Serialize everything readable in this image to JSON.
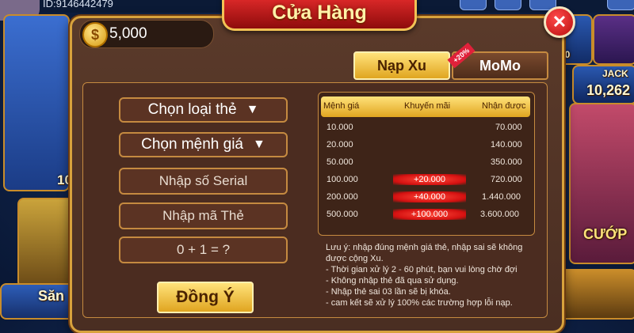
{
  "background": {
    "user_id": "ID:9146442479",
    "left_label": "Săn",
    "left_label2": "10",
    "right_jackpot_label": "JACK",
    "right_jackpot_value": "10,262",
    "right_top_value": "00",
    "right_label": "CƯỚP"
  },
  "dialog": {
    "title": "Cửa Hàng",
    "balance": "5,000",
    "coin_symbol": "$",
    "tabs": [
      {
        "label": "Nạp Xu",
        "active": true
      },
      {
        "label": "MoMo",
        "active": false,
        "badge": "+20%"
      }
    ],
    "form": {
      "card_type": "Chọn loại thẻ",
      "card_value": "Chọn mệnh giá",
      "serial_placeholder": "Nhập số Serial",
      "code_placeholder": "Nhập mã Thẻ",
      "captcha": "0 + 1 = ?",
      "arrow": "▼",
      "submit_label": "Đồng Ý"
    },
    "rate_table": {
      "headers": [
        "Mệnh giá",
        "Khuyến mãi",
        "Nhận được"
      ],
      "rows": [
        {
          "value": "10.000",
          "bonus": "",
          "receive": "70.000"
        },
        {
          "value": "20.000",
          "bonus": "",
          "receive": "140.000"
        },
        {
          "value": "50.000",
          "bonus": "",
          "receive": "350.000"
        },
        {
          "value": "100.000",
          "bonus": "+20.000",
          "receive": "720.000"
        },
        {
          "value": "200.000",
          "bonus": "+40.000",
          "receive": "1.440.000"
        },
        {
          "value": "500.000",
          "bonus": "+100.000",
          "receive": "3.600.000"
        }
      ]
    },
    "notes": [
      "Lưu ý: nhập đúng mệnh giá thẻ, nhập sai sẽ không",
      "được cộng Xu.",
      "- Thời gian xử lý 2 - 60 phút, bạn vui lòng chờ đợi",
      "- Không nhập thẻ đã qua sử dụng.",
      "- Nhập thẻ sai 03 lần sẽ bị khóa.",
      "- cam kết sẽ xử lý 100% các trường hợp lỗi nạp."
    ]
  },
  "colors": {
    "panel": "#4a2e22",
    "gold": "#e0a520",
    "header_red": "#c01818",
    "bonus_red": "#d41010"
  }
}
